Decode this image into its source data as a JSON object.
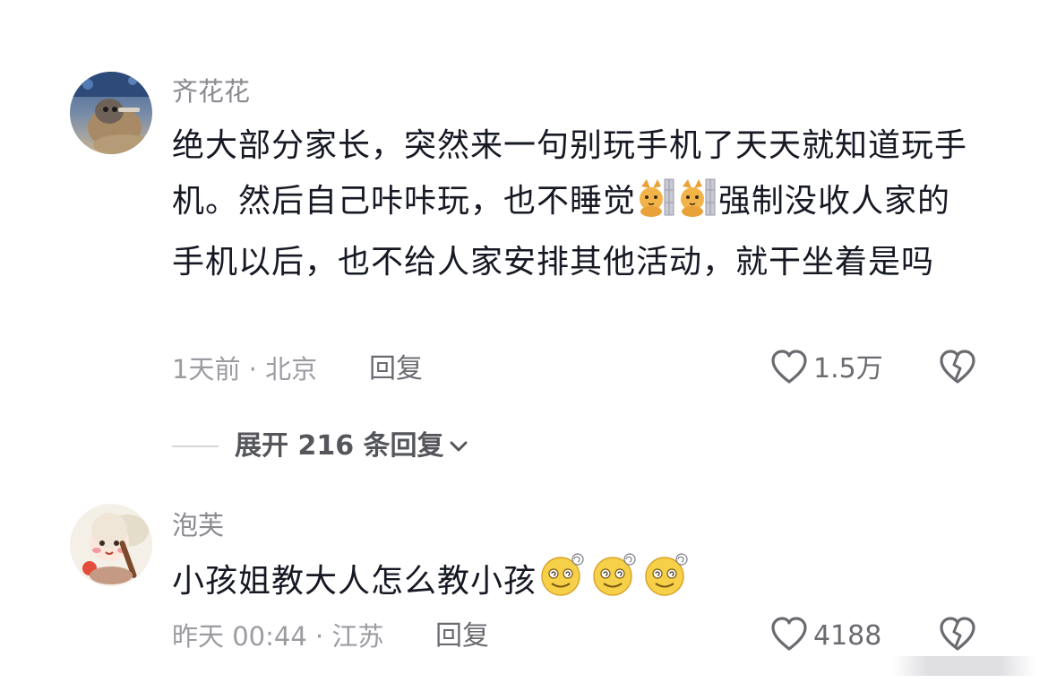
{
  "comments": [
    {
      "username": "齐花花",
      "body_parts": [
        "绝大部分家长，突然来一句别玩手机了天天就知道玩手机。然后自己咔咔玩，也不睡觉",
        "强制没收人家的手机以后，也不给人家安排其他活动，就干坐着是吗"
      ],
      "inline_emojis": [
        "cat-emoji",
        "cat-emoji"
      ],
      "meta": "1天前 · 北京",
      "reply_label": "回复",
      "like_count": "1.5万"
    },
    {
      "username": "泡芙",
      "body_parts": [
        "小孩姐教大人怎么教小孩"
      ],
      "inline_emojis": [
        "dizzy-smile-emoji",
        "dizzy-smile-emoji",
        "dizzy-smile-emoji"
      ],
      "meta": "昨天 00:44 · 江苏",
      "reply_label": "回复",
      "like_count": "4188"
    }
  ],
  "expand_replies": {
    "label": "展开 216 条回复"
  },
  "colors": {
    "username": "#8a8b91",
    "body": "#161823",
    "meta": "#9b9ca1",
    "action": "#6a6b70"
  }
}
